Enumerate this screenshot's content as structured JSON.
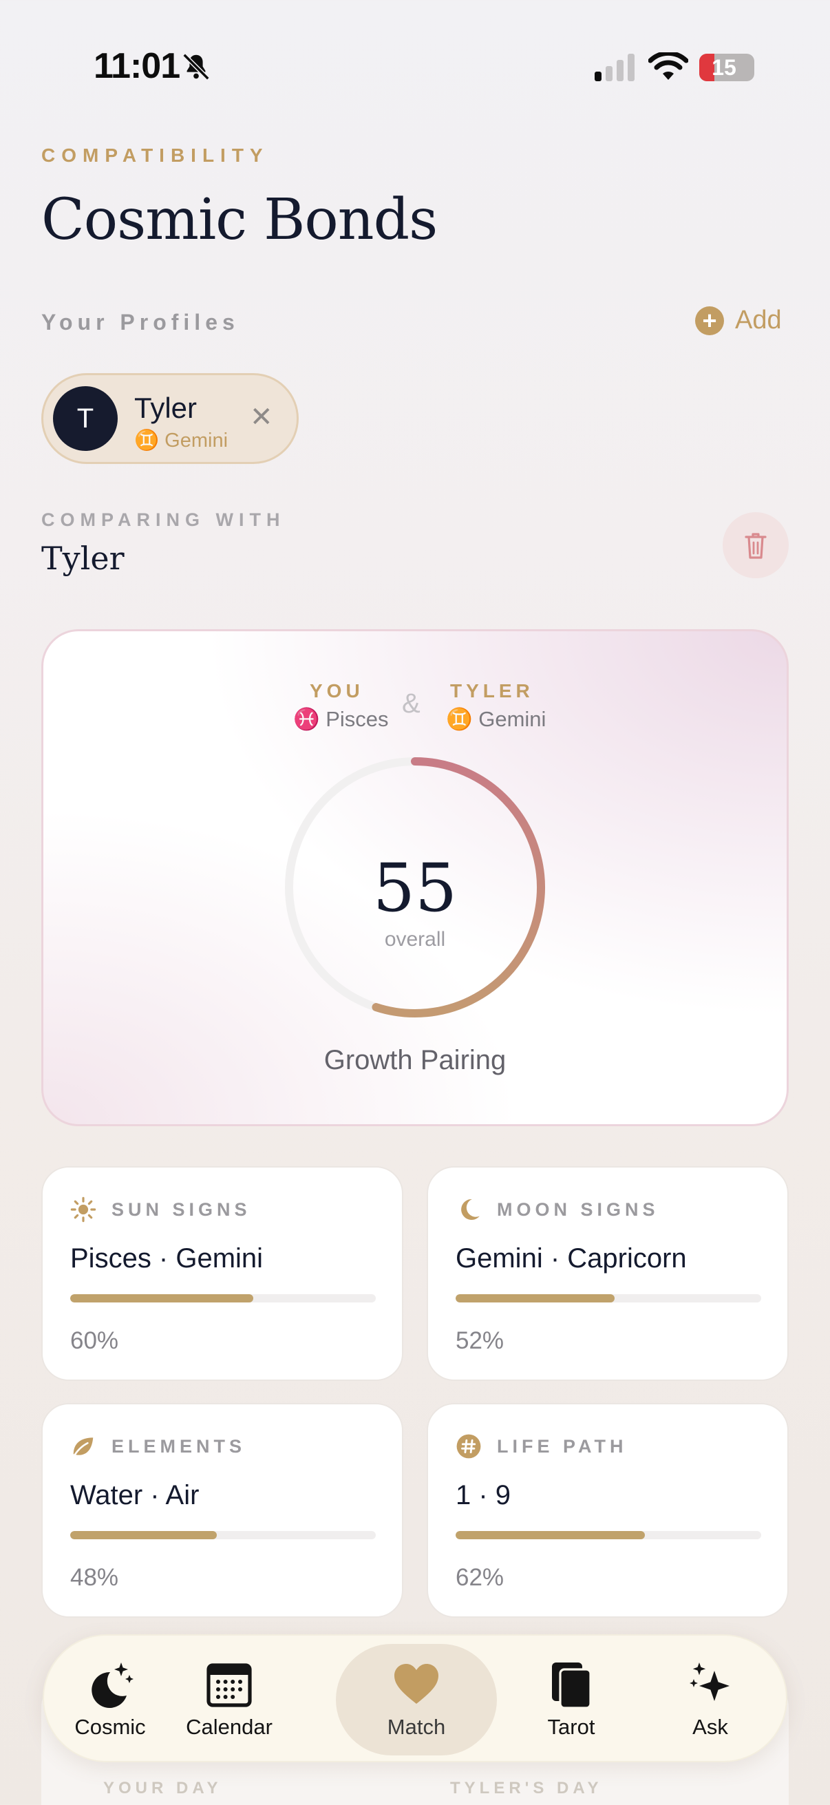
{
  "status": {
    "time": "11:01",
    "battery": "15"
  },
  "header": {
    "eyebrow": "COMPATIBILITY",
    "title": "Cosmic Bonds"
  },
  "profiles": {
    "label": "Your Profiles",
    "add_label": "Add",
    "items": [
      {
        "initial": "T",
        "name": "Tyler",
        "sign": "♊ Gemini"
      }
    ]
  },
  "comparing": {
    "label": "COMPARING WITH",
    "name": "Tyler"
  },
  "hero": {
    "you_label": "YOU",
    "you_sign": "♓ Pisces",
    "amp": "&",
    "other_label": "TYLER",
    "other_sign": "♊ Gemini",
    "score": "55",
    "score_value": 55,
    "score_sub": "overall",
    "verdict": "Growth Pairing"
  },
  "cards": [
    {
      "label": "SUN SIGNS",
      "value": "Pisces · Gemini",
      "percent": "60%",
      "fraction": 0.6,
      "icon": "sun-icon"
    },
    {
      "label": "MOON SIGNS",
      "value": "Gemini · Capricorn",
      "percent": "52%",
      "fraction": 0.52,
      "icon": "moon-icon"
    },
    {
      "label": "ELEMENTS",
      "value": "Water · Air",
      "percent": "48%",
      "fraction": 0.48,
      "icon": "leaf-icon"
    },
    {
      "label": "LIFE PATH",
      "value": "1 · 9",
      "percent": "62%",
      "fraction": 0.62,
      "icon": "hash-icon"
    }
  ],
  "peek": {
    "left": "YOUR DAY",
    "right": "TYLER'S DAY"
  },
  "tabs": [
    {
      "label": "Cosmic",
      "icon": "moon-stars-icon"
    },
    {
      "label": "Calendar",
      "icon": "calendar-icon"
    },
    {
      "label": "Match",
      "icon": "heart-icon",
      "active": true
    },
    {
      "label": "Tarot",
      "icon": "cards-icon"
    },
    {
      "label": "Ask",
      "icon": "sparkles-icon"
    }
  ],
  "colors": {
    "accent": "#c29d62",
    "ink": "#141a2e",
    "ring_start": "#c87c86",
    "ring_end": "#c49a72"
  }
}
